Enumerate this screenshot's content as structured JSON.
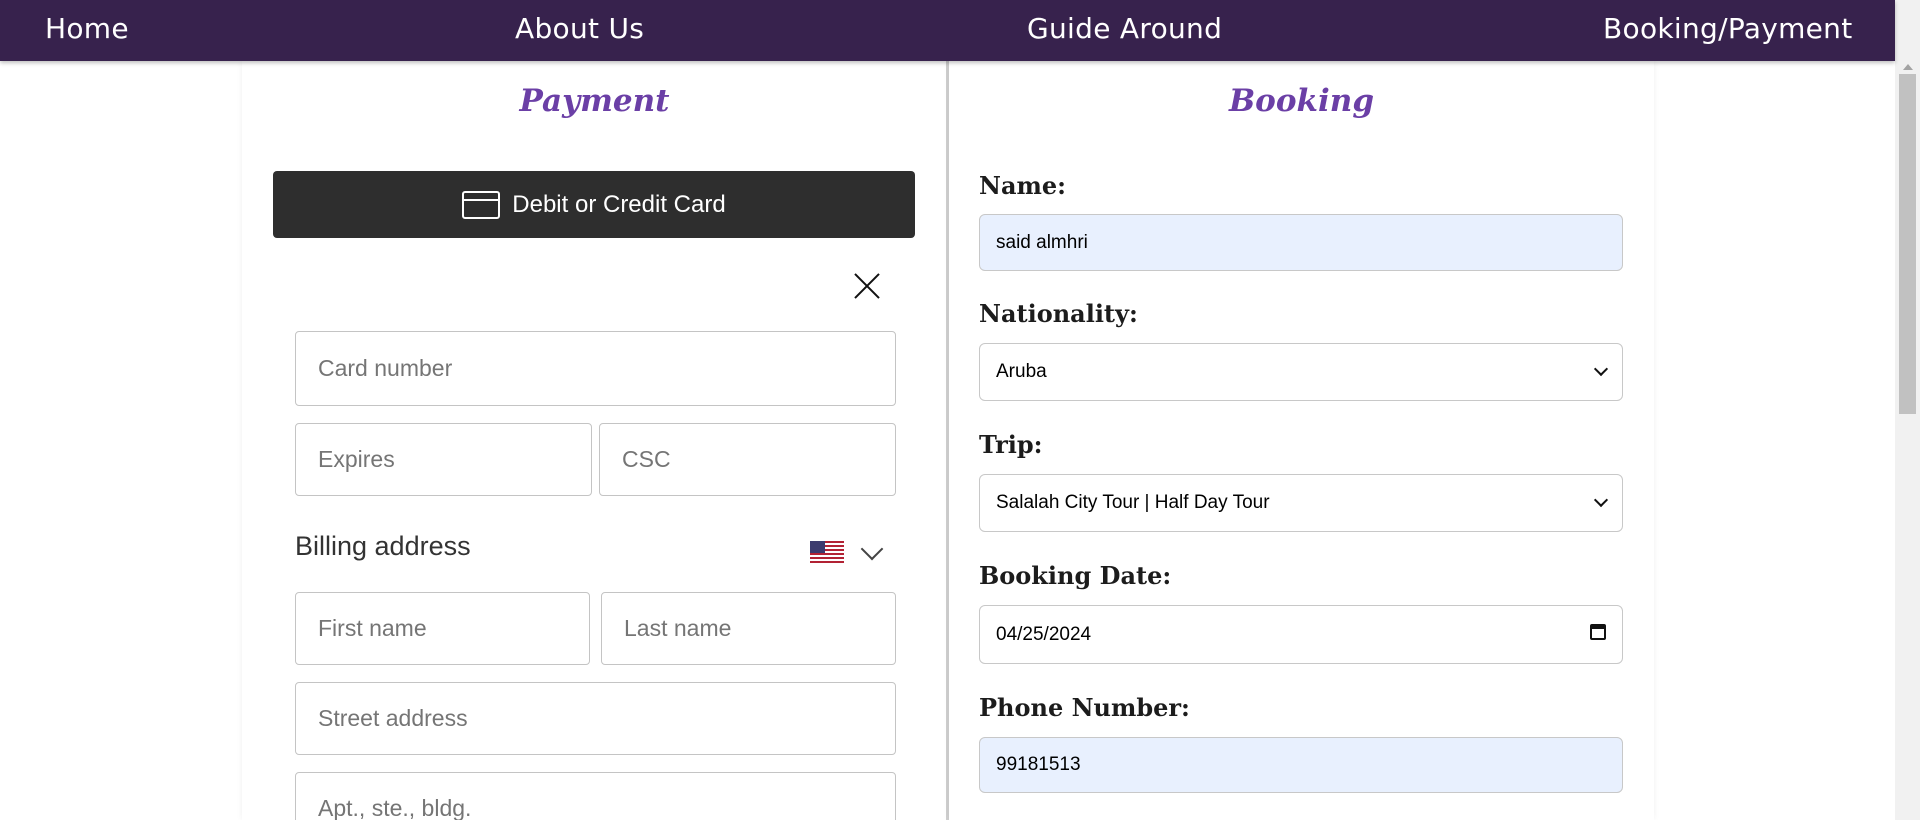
{
  "nav": {
    "home": "Home",
    "about": "About Us",
    "guide": "Guide Around",
    "booking_payment": "Booking/Payment"
  },
  "payment": {
    "title": "Payment",
    "card_button": "Debit or Credit Card",
    "card_number_placeholder": "Card number",
    "expires_placeholder": "Expires",
    "csc_placeholder": "CSC",
    "billing_label": "Billing address",
    "first_name_placeholder": "First name",
    "last_name_placeholder": "Last name",
    "street_placeholder": "Street address",
    "apt_placeholder": "Apt., ste., bldg."
  },
  "booking": {
    "title": "Booking",
    "name_label": "Name:",
    "name_value": "said almhri",
    "nationality_label": "Nationality:",
    "nationality_value": "Aruba",
    "trip_label": "Trip:",
    "trip_value": "Salalah City Tour | Half Day Tour",
    "date_label": "Booking Date:",
    "date_value": "04/25/2024",
    "phone_label": "Phone Number:",
    "phone_value": "99181513"
  },
  "colors": {
    "nav_bg": "#37224d",
    "title_accent": "#6b3fa6",
    "card_button_bg": "#2e2e2e",
    "autofill_bg": "#e8f0fe"
  },
  "icons": [
    "card-icon",
    "close-icon",
    "us-flag-icon",
    "chevron-down-icon",
    "calendar-icon"
  ]
}
